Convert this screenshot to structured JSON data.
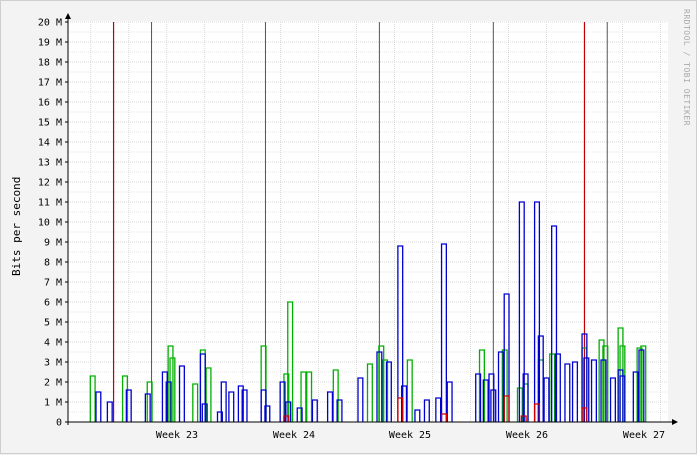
{
  "chart_data": {
    "type": "line",
    "title": "",
    "xlabel": "",
    "ylabel": "Bits per second",
    "credit": "RRDTOOL / TOBI OETIKER",
    "y_unit": "M",
    "ylim": [
      0,
      20
    ],
    "y_ticks": [
      "0",
      "1 M",
      "2 M",
      "3 M",
      "4 M",
      "5 M",
      "6 M",
      "7 M",
      "8 M",
      "9 M",
      "10 M",
      "11 M",
      "12 M",
      "13 M",
      "14 M",
      "15 M",
      "16 M",
      "17 M",
      "18 M",
      "19 M",
      "20 M"
    ],
    "x_ticks": [
      "Week 23",
      "Week 24",
      "Week 25",
      "Week 26",
      "Week 27"
    ],
    "grid": true,
    "colors": {
      "major_grid": "#555555",
      "minor_grid": "#d0d0d0",
      "period_marker": "#c00000",
      "axis": "#000000",
      "plot_bg": "#ffffff"
    },
    "series": [
      {
        "color": "#00b000",
        "points": [
          [
            0.05,
            2.3
          ],
          [
            0.9,
            2.3
          ],
          [
            1.55,
            2.0
          ],
          [
            2.1,
            3.8
          ],
          [
            2.15,
            3.2
          ],
          [
            2.75,
            1.9
          ],
          [
            2.95,
            3.6
          ],
          [
            3.1,
            2.7
          ],
          [
            4.55,
            3.8
          ],
          [
            5.15,
            2.4
          ],
          [
            5.25,
            6.0
          ],
          [
            5.6,
            2.5
          ],
          [
            5.75,
            2.5
          ],
          [
            6.45,
            2.6
          ],
          [
            7.35,
            2.9
          ],
          [
            7.65,
            3.8
          ],
          [
            7.75,
            3.1
          ],
          [
            8.4,
            3.1
          ],
          [
            10.3,
            3.6
          ],
          [
            10.9,
            3.6
          ],
          [
            11.3,
            1.7
          ],
          [
            11.45,
            1.9
          ],
          [
            11.85,
            3.1
          ],
          [
            12.15,
            3.4
          ],
          [
            13.0,
            3.7
          ],
          [
            13.45,
            4.1
          ],
          [
            13.55,
            3.8
          ],
          [
            13.95,
            4.7
          ],
          [
            14.0,
            3.8
          ],
          [
            14.45,
            3.7
          ],
          [
            14.55,
            3.8
          ]
        ]
      },
      {
        "color": "#0000d0",
        "points": [
          [
            0.2,
            1.5
          ],
          [
            0.5,
            1.0
          ],
          [
            1.0,
            1.6
          ],
          [
            1.5,
            1.4
          ],
          [
            1.95,
            2.5
          ],
          [
            2.05,
            2.0
          ],
          [
            2.4,
            2.8
          ],
          [
            2.95,
            3.4
          ],
          [
            3.0,
            0.9
          ],
          [
            3.4,
            0.5
          ],
          [
            3.5,
            2.0
          ],
          [
            3.7,
            1.5
          ],
          [
            3.95,
            1.8
          ],
          [
            4.05,
            1.6
          ],
          [
            4.55,
            1.6
          ],
          [
            4.65,
            0.8
          ],
          [
            5.05,
            2.0
          ],
          [
            5.2,
            1.0
          ],
          [
            5.5,
            0.7
          ],
          [
            5.9,
            1.1
          ],
          [
            6.3,
            1.5
          ],
          [
            6.55,
            1.1
          ],
          [
            7.1,
            2.2
          ],
          [
            7.6,
            3.5
          ],
          [
            7.85,
            3.0
          ],
          [
            8.15,
            8.8
          ],
          [
            8.25,
            1.8
          ],
          [
            8.6,
            0.6
          ],
          [
            8.85,
            1.1
          ],
          [
            9.15,
            1.2
          ],
          [
            9.3,
            8.9
          ],
          [
            9.45,
            2.0
          ],
          [
            10.2,
            2.4
          ],
          [
            10.4,
            2.1
          ],
          [
            10.55,
            2.4
          ],
          [
            10.6,
            1.6
          ],
          [
            10.8,
            3.5
          ],
          [
            10.95,
            6.4
          ],
          [
            11.35,
            11.0
          ],
          [
            11.45,
            2.4
          ],
          [
            11.75,
            11.0
          ],
          [
            11.85,
            4.3
          ],
          [
            12.0,
            2.2
          ],
          [
            12.2,
            9.8
          ],
          [
            12.3,
            3.4
          ],
          [
            12.55,
            2.9
          ],
          [
            12.75,
            3.0
          ],
          [
            13.0,
            4.4
          ],
          [
            13.05,
            3.2
          ],
          [
            13.25,
            3.1
          ],
          [
            13.5,
            3.1
          ],
          [
            13.75,
            2.2
          ],
          [
            13.95,
            2.6
          ],
          [
            14.0,
            2.3
          ],
          [
            14.35,
            2.5
          ],
          [
            14.5,
            3.6
          ]
        ]
      },
      {
        "color": "#d00000",
        "points": [
          [
            8.15,
            1.2
          ],
          [
            9.3,
            0.4
          ],
          [
            10.95,
            1.3
          ],
          [
            11.75,
            0.9
          ],
          [
            13.0,
            0.7
          ],
          [
            11.4,
            0.3
          ],
          [
            5.15,
            0.3
          ]
        ]
      }
    ],
    "period_markers": [
      0.6,
      13.0
    ],
    "day_range": [
      -0.6,
      15.2
    ]
  }
}
